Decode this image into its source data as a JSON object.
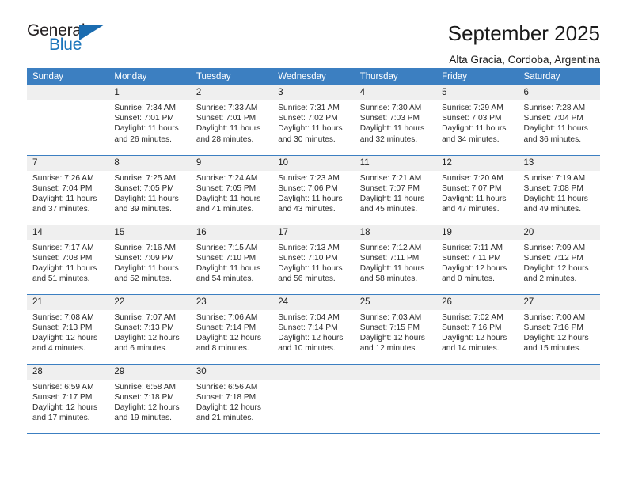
{
  "brand": {
    "name_top": "General",
    "name_bottom": "Blue",
    "logo_icon": "triangle-icon",
    "accent_color": "#1b75bb"
  },
  "header": {
    "title": "September 2025",
    "location": "Alta Gracia, Cordoba, Argentina"
  },
  "theme": {
    "header_row_bg": "#3c7fc1",
    "daynum_bg": "#efefef",
    "text": "#2c2c2c"
  },
  "weekdays": [
    "Sunday",
    "Monday",
    "Tuesday",
    "Wednesday",
    "Thursday",
    "Friday",
    "Saturday"
  ],
  "labels": {
    "sunrise_prefix": "Sunrise:",
    "sunset_prefix": "Sunset:",
    "daylight_prefix": "Daylight:"
  },
  "weeks": [
    [
      {
        "day": "",
        "blank": true,
        "sunrise": "",
        "sunset": "",
        "daylight_a": "",
        "daylight_b": ""
      },
      {
        "day": "1",
        "sunrise": "Sunrise: 7:34 AM",
        "sunset": "Sunset: 7:01 PM",
        "daylight_a": "Daylight: 11 hours",
        "daylight_b": "and 26 minutes."
      },
      {
        "day": "2",
        "sunrise": "Sunrise: 7:33 AM",
        "sunset": "Sunset: 7:01 PM",
        "daylight_a": "Daylight: 11 hours",
        "daylight_b": "and 28 minutes."
      },
      {
        "day": "3",
        "sunrise": "Sunrise: 7:31 AM",
        "sunset": "Sunset: 7:02 PM",
        "daylight_a": "Daylight: 11 hours",
        "daylight_b": "and 30 minutes."
      },
      {
        "day": "4",
        "sunrise": "Sunrise: 7:30 AM",
        "sunset": "Sunset: 7:03 PM",
        "daylight_a": "Daylight: 11 hours",
        "daylight_b": "and 32 minutes."
      },
      {
        "day": "5",
        "sunrise": "Sunrise: 7:29 AM",
        "sunset": "Sunset: 7:03 PM",
        "daylight_a": "Daylight: 11 hours",
        "daylight_b": "and 34 minutes."
      },
      {
        "day": "6",
        "sunrise": "Sunrise: 7:28 AM",
        "sunset": "Sunset: 7:04 PM",
        "daylight_a": "Daylight: 11 hours",
        "daylight_b": "and 36 minutes."
      }
    ],
    [
      {
        "day": "7",
        "sunrise": "Sunrise: 7:26 AM",
        "sunset": "Sunset: 7:04 PM",
        "daylight_a": "Daylight: 11 hours",
        "daylight_b": "and 37 minutes."
      },
      {
        "day": "8",
        "sunrise": "Sunrise: 7:25 AM",
        "sunset": "Sunset: 7:05 PM",
        "daylight_a": "Daylight: 11 hours",
        "daylight_b": "and 39 minutes."
      },
      {
        "day": "9",
        "sunrise": "Sunrise: 7:24 AM",
        "sunset": "Sunset: 7:05 PM",
        "daylight_a": "Daylight: 11 hours",
        "daylight_b": "and 41 minutes."
      },
      {
        "day": "10",
        "sunrise": "Sunrise: 7:23 AM",
        "sunset": "Sunset: 7:06 PM",
        "daylight_a": "Daylight: 11 hours",
        "daylight_b": "and 43 minutes."
      },
      {
        "day": "11",
        "sunrise": "Sunrise: 7:21 AM",
        "sunset": "Sunset: 7:07 PM",
        "daylight_a": "Daylight: 11 hours",
        "daylight_b": "and 45 minutes."
      },
      {
        "day": "12",
        "sunrise": "Sunrise: 7:20 AM",
        "sunset": "Sunset: 7:07 PM",
        "daylight_a": "Daylight: 11 hours",
        "daylight_b": "and 47 minutes."
      },
      {
        "day": "13",
        "sunrise": "Sunrise: 7:19 AM",
        "sunset": "Sunset: 7:08 PM",
        "daylight_a": "Daylight: 11 hours",
        "daylight_b": "and 49 minutes."
      }
    ],
    [
      {
        "day": "14",
        "sunrise": "Sunrise: 7:17 AM",
        "sunset": "Sunset: 7:08 PM",
        "daylight_a": "Daylight: 11 hours",
        "daylight_b": "and 51 minutes."
      },
      {
        "day": "15",
        "sunrise": "Sunrise: 7:16 AM",
        "sunset": "Sunset: 7:09 PM",
        "daylight_a": "Daylight: 11 hours",
        "daylight_b": "and 52 minutes."
      },
      {
        "day": "16",
        "sunrise": "Sunrise: 7:15 AM",
        "sunset": "Sunset: 7:10 PM",
        "daylight_a": "Daylight: 11 hours",
        "daylight_b": "and 54 minutes."
      },
      {
        "day": "17",
        "sunrise": "Sunrise: 7:13 AM",
        "sunset": "Sunset: 7:10 PM",
        "daylight_a": "Daylight: 11 hours",
        "daylight_b": "and 56 minutes."
      },
      {
        "day": "18",
        "sunrise": "Sunrise: 7:12 AM",
        "sunset": "Sunset: 7:11 PM",
        "daylight_a": "Daylight: 11 hours",
        "daylight_b": "and 58 minutes."
      },
      {
        "day": "19",
        "sunrise": "Sunrise: 7:11 AM",
        "sunset": "Sunset: 7:11 PM",
        "daylight_a": "Daylight: 12 hours",
        "daylight_b": "and 0 minutes."
      },
      {
        "day": "20",
        "sunrise": "Sunrise: 7:09 AM",
        "sunset": "Sunset: 7:12 PM",
        "daylight_a": "Daylight: 12 hours",
        "daylight_b": "and 2 minutes."
      }
    ],
    [
      {
        "day": "21",
        "sunrise": "Sunrise: 7:08 AM",
        "sunset": "Sunset: 7:13 PM",
        "daylight_a": "Daylight: 12 hours",
        "daylight_b": "and 4 minutes."
      },
      {
        "day": "22",
        "sunrise": "Sunrise: 7:07 AM",
        "sunset": "Sunset: 7:13 PM",
        "daylight_a": "Daylight: 12 hours",
        "daylight_b": "and 6 minutes."
      },
      {
        "day": "23",
        "sunrise": "Sunrise: 7:06 AM",
        "sunset": "Sunset: 7:14 PM",
        "daylight_a": "Daylight: 12 hours",
        "daylight_b": "and 8 minutes."
      },
      {
        "day": "24",
        "sunrise": "Sunrise: 7:04 AM",
        "sunset": "Sunset: 7:14 PM",
        "daylight_a": "Daylight: 12 hours",
        "daylight_b": "and 10 minutes."
      },
      {
        "day": "25",
        "sunrise": "Sunrise: 7:03 AM",
        "sunset": "Sunset: 7:15 PM",
        "daylight_a": "Daylight: 12 hours",
        "daylight_b": "and 12 minutes."
      },
      {
        "day": "26",
        "sunrise": "Sunrise: 7:02 AM",
        "sunset": "Sunset: 7:16 PM",
        "daylight_a": "Daylight: 12 hours",
        "daylight_b": "and 14 minutes."
      },
      {
        "day": "27",
        "sunrise": "Sunrise: 7:00 AM",
        "sunset": "Sunset: 7:16 PM",
        "daylight_a": "Daylight: 12 hours",
        "daylight_b": "and 15 minutes."
      }
    ],
    [
      {
        "day": "28",
        "sunrise": "Sunrise: 6:59 AM",
        "sunset": "Sunset: 7:17 PM",
        "daylight_a": "Daylight: 12 hours",
        "daylight_b": "and 17 minutes."
      },
      {
        "day": "29",
        "sunrise": "Sunrise: 6:58 AM",
        "sunset": "Sunset: 7:18 PM",
        "daylight_a": "Daylight: 12 hours",
        "daylight_b": "and 19 minutes."
      },
      {
        "day": "30",
        "sunrise": "Sunrise: 6:56 AM",
        "sunset": "Sunset: 7:18 PM",
        "daylight_a": "Daylight: 12 hours",
        "daylight_b": "and 21 minutes."
      },
      {
        "day": "",
        "blank": true,
        "sunrise": "",
        "sunset": "",
        "daylight_a": "",
        "daylight_b": ""
      },
      {
        "day": "",
        "blank": true,
        "sunrise": "",
        "sunset": "",
        "daylight_a": "",
        "daylight_b": ""
      },
      {
        "day": "",
        "blank": true,
        "sunrise": "",
        "sunset": "",
        "daylight_a": "",
        "daylight_b": ""
      },
      {
        "day": "",
        "blank": true,
        "sunrise": "",
        "sunset": "",
        "daylight_a": "",
        "daylight_b": ""
      }
    ]
  ]
}
